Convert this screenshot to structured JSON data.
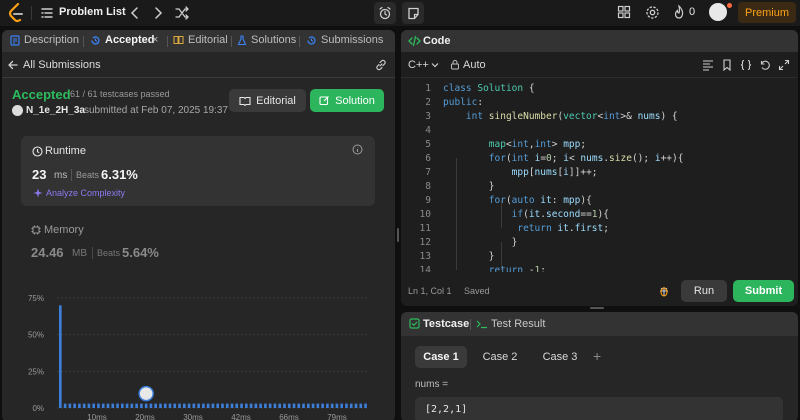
{
  "topbar": {
    "title": "Problem List",
    "streak": "0",
    "premium": "Premium"
  },
  "left": {
    "tabs": {
      "description": "Description",
      "accepted": "Accepted",
      "close": "×",
      "editorial": "Editorial",
      "solutions": "Solutions",
      "submissions": "Submissions"
    },
    "all_submissions": "All Submissions",
    "status": "Accepted",
    "testcases": "61 / 61 testcases passed",
    "user": "N_1e_2H_3a",
    "submitted": "submitted at Feb 07, 2025 19:37",
    "buttons": {
      "editorial": "Editorial",
      "solution": "Solution"
    },
    "runtime": {
      "label": "Runtime",
      "value": "23",
      "unit": "ms",
      "beats_label": "Beats",
      "beats": "6.31%",
      "analyze": "Analyze Complexity"
    },
    "memory": {
      "label": "Memory",
      "value": "24.46",
      "unit": "MB",
      "beats_label": "Beats",
      "beats": "5.64%"
    }
  },
  "chart_data": {
    "type": "bar",
    "y_ticks": [
      "75%",
      "50%",
      "25%",
      "0%"
    ],
    "x_ticks": [
      "10ms",
      "20ms",
      "30ms",
      "42ms",
      "66ms",
      "79ms"
    ],
    "values": [
      70,
      3,
      3,
      3,
      3,
      3,
      3,
      3,
      3,
      3,
      3,
      3,
      3,
      3,
      3,
      3,
      3,
      3,
      3,
      3,
      3,
      3,
      3,
      3,
      3,
      3,
      3,
      3,
      3,
      3,
      3,
      3,
      3,
      3,
      3,
      3,
      3,
      3,
      3,
      3,
      3,
      3,
      3,
      3,
      3,
      3,
      3,
      3,
      3,
      3,
      3,
      3,
      3,
      3,
      3,
      3,
      3,
      3,
      3,
      3,
      3,
      3,
      3,
      3,
      3
    ],
    "ylim": [
      0,
      75
    ],
    "bar_color": "#3d7ed9",
    "marker_bar_index": 18
  },
  "code": {
    "title": "Code",
    "language": "C++",
    "mode": "Auto",
    "line_numbers": [
      "1",
      "2",
      "3",
      "4",
      "5",
      "6",
      "7",
      "8",
      "9",
      "10",
      "11",
      "12",
      "13",
      "14"
    ],
    "position": "Ln 1, Col 1",
    "saved": "Saved",
    "run": "Run",
    "submit": "Submit"
  },
  "testcase": {
    "title": "Testcase",
    "result_title": "Test Result",
    "cases": [
      "Case 1",
      "Case 2",
      "Case 3"
    ],
    "add": "+",
    "param_label": "nums =",
    "param_value": "[2,2,1]"
  }
}
